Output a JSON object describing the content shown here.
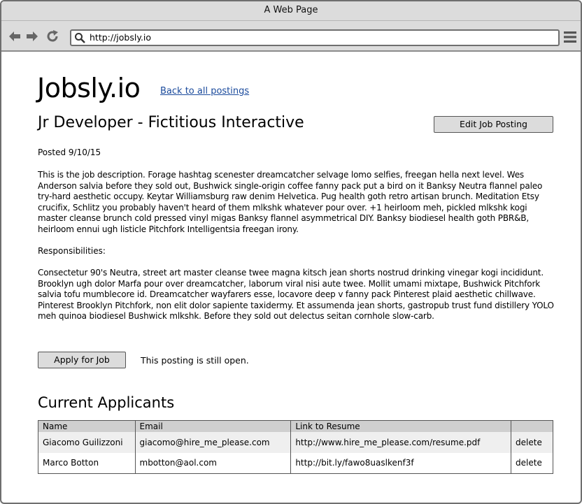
{
  "window": {
    "title": "A Web Page"
  },
  "browser": {
    "url": "http://jobsly.io",
    "icons": {
      "back": "arrow-left-icon",
      "forward": "arrow-right-icon",
      "reload": "reload-icon",
      "search": "search-icon",
      "menu": "hamburger-menu-icon"
    }
  },
  "header": {
    "logo": "Jobsly.io",
    "back_link": "Back to all postings"
  },
  "job": {
    "title": "Jr Developer - Fictitious Interactive",
    "edit_label": "Edit Job Posting",
    "posted": "Posted 9/10/15",
    "description": "This is the job description. Forage hashtag scenester dreamcatcher selvage lomo selfies, freegan hella next level. Wes Anderson salvia before they sold out, Bushwick single-origin coffee fanny pack put a bird on it Banksy Neutra flannel paleo try-hard aesthetic occupy. Keytar Williamsburg raw denim Helvetica. Pug health goth retro artisan brunch. Meditation Etsy crucifix, Schlitz you probably haven't heard of them mlkshk whatever pour over. +1 heirloom meh, pickled mlkshk kogi master cleanse brunch cold pressed vinyl migas Banksy flannel asymmetrical DIY. Banksy biodiesel health goth PBR&B, heirloom ennui ugh listicle Pitchfork Intelligentsia freegan irony.",
    "responsibilities_label": "Responsibilities:",
    "responsibilities": "Consectetur 90's Neutra, street art master cleanse twee magna kitsch jean shorts nostrud drinking vinegar kogi incididunt. Brooklyn ugh dolor Marfa pour over dreamcatcher, laborum viral nisi aute twee. Mollit umami mixtape, Bushwick Pitchfork salvia tofu mumblecore id. Dreamcatcher wayfarers esse, locavore deep v fanny pack Pinterest plaid aesthetic chillwave. Pinterest Brooklyn Pitchfork, non elit dolor sapiente taxidermy. Et assumenda jean shorts, gastropub trust fund distillery YOLO meh quinoa biodiesel Bushwick mlkshk. Before they sold out delectus seitan cornhole slow-carb.",
    "apply_label": "Apply for Job",
    "status_text": "This posting is still open."
  },
  "applicants": {
    "title": "Current Applicants",
    "columns": [
      "Name",
      "Email",
      "Link to Resume",
      ""
    ],
    "rows": [
      {
        "name": "Giacomo Guilizzoni",
        "email": "giacomo@hire_me_please.com",
        "resume": "http://www.hire_me_please.com/resume.pdf",
        "action": "delete"
      },
      {
        "name": "Marco Botton",
        "email": "mbotton@aol.com",
        "resume": "http://bit.ly/fawo8uaslkenf3f",
        "action": "delete"
      }
    ]
  }
}
